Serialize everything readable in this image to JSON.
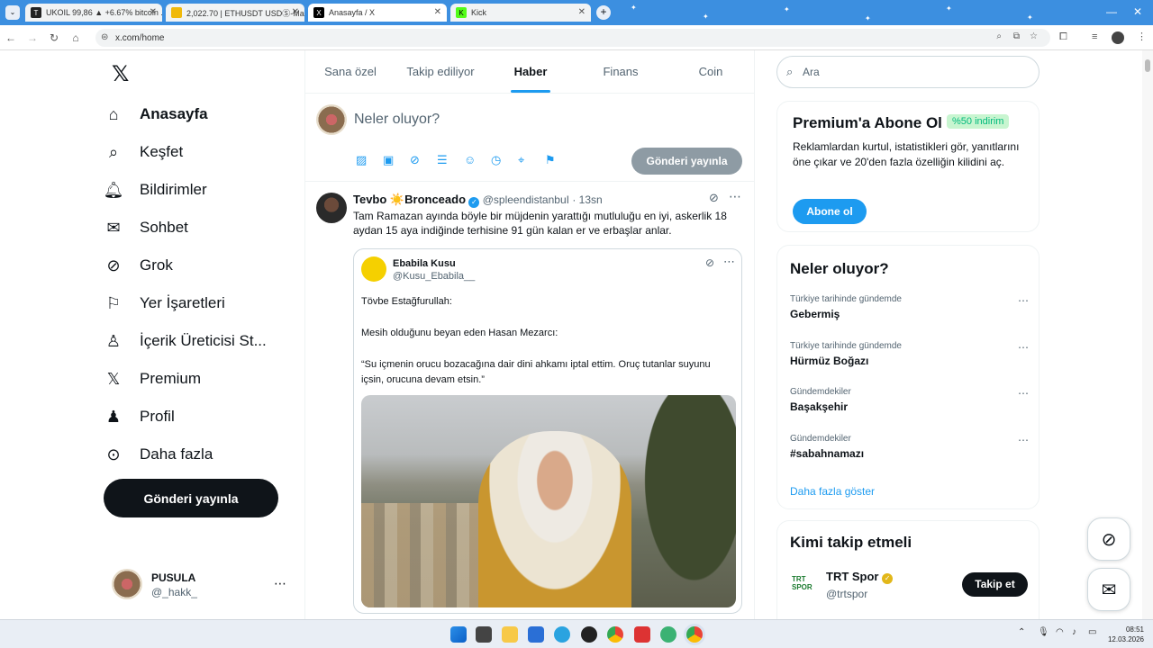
{
  "browser": {
    "tabs": [
      {
        "title": "UKOIL 99,86 ▲ +6.67% bitcoin ..."
      },
      {
        "title": "2,022.70 | ETHUSDT USDⓈ-Ma..."
      },
      {
        "title": "Anasayfa / X"
      },
      {
        "title": "Kick"
      }
    ],
    "address": "x.com/home"
  },
  "nav": {
    "items": [
      {
        "label": "Anasayfa",
        "icon": "home-icon"
      },
      {
        "label": "Keşfet",
        "icon": "search-icon"
      },
      {
        "label": "Bildirimler",
        "icon": "bell-icon"
      },
      {
        "label": "Sohbet",
        "icon": "mail-icon"
      },
      {
        "label": "Grok",
        "icon": "grok-icon"
      },
      {
        "label": "Yer İşaretleri",
        "icon": "bookmark-icon"
      },
      {
        "label": "İçerik Üreticisi St...",
        "icon": "creator-icon"
      },
      {
        "label": "Premium",
        "icon": "x-icon"
      },
      {
        "label": "Profil",
        "icon": "person-icon"
      },
      {
        "label": "Daha fazla",
        "icon": "more-icon"
      }
    ],
    "post_button": "Gönderi yayınla",
    "profile": {
      "name": "PUSULA",
      "handle": "@_hakk_"
    }
  },
  "main": {
    "tabs": [
      "Sana özel",
      "Takip ediliyor",
      "Haber",
      "Finans",
      "Coin"
    ],
    "active_tab": "Haber",
    "compose_placeholder": "Neler oluyor?",
    "compose_button": "Gönderi yayınla",
    "tweet": {
      "name": "Tevbo ☀️Bronceado",
      "handle": "@spleendistanbuI",
      "time": "· 13sn",
      "text": "Tam Ramazan ayında böyle bir müjdenin yarattığı mutluluğu en iyi, askerlik 18 aydan 15 aya indiğinde terhisine 91 gün kalan er ve erbaşlar anlar.",
      "quote": {
        "name": "Ebabila Kusu",
        "handle": "@Kusu_Ebabila__",
        "line1": "Tövbe Estağfurullah:",
        "line2": "Mesih olduğunu beyan eden Hasan Mezarcı:",
        "line3": "“Su içmenin orucu bozacağına dair dini ahkamı iptal ettim. Oruç tutanlar suyunu içsin, orucuna devam etsin.”"
      }
    }
  },
  "sidebar": {
    "search_placeholder": "Ara",
    "premium": {
      "title": "Premium'a Abone Ol",
      "badge": "%50 indirim",
      "text": "Reklamlardan kurtul, istatistikleri gör, yanıtlarını öne çıkar ve 20'den fazla özelliğin kilidini aç.",
      "button": "Abone ol"
    },
    "trends": {
      "title": "Neler oluyor?",
      "items": [
        {
          "meta": "Türkiye tarihinde gündemde",
          "name": "Gebermiş"
        },
        {
          "meta": "Türkiye tarihinde gündemde",
          "name": "Hürmüz Boğazı"
        },
        {
          "meta": "Gündemdekiler",
          "name": "Başakşehir"
        },
        {
          "meta": "Gündemdekiler",
          "name": "#sabahnamazı"
        }
      ],
      "show_more": "Daha fazla göster"
    },
    "follow": {
      "title": "Kimi takip etmeli",
      "account": {
        "name": "TRT Spor",
        "handle": "@trtspor",
        "logo": "TRT SPOR"
      },
      "button": "Takip et"
    }
  },
  "taskbar": {
    "time": "08:51",
    "date": "12.03.2026"
  },
  "colors": {
    "accent": "#1d9bf0",
    "dark": "#0f1419",
    "muted": "#536471",
    "browser_tabbar": "#3c8fe0"
  }
}
